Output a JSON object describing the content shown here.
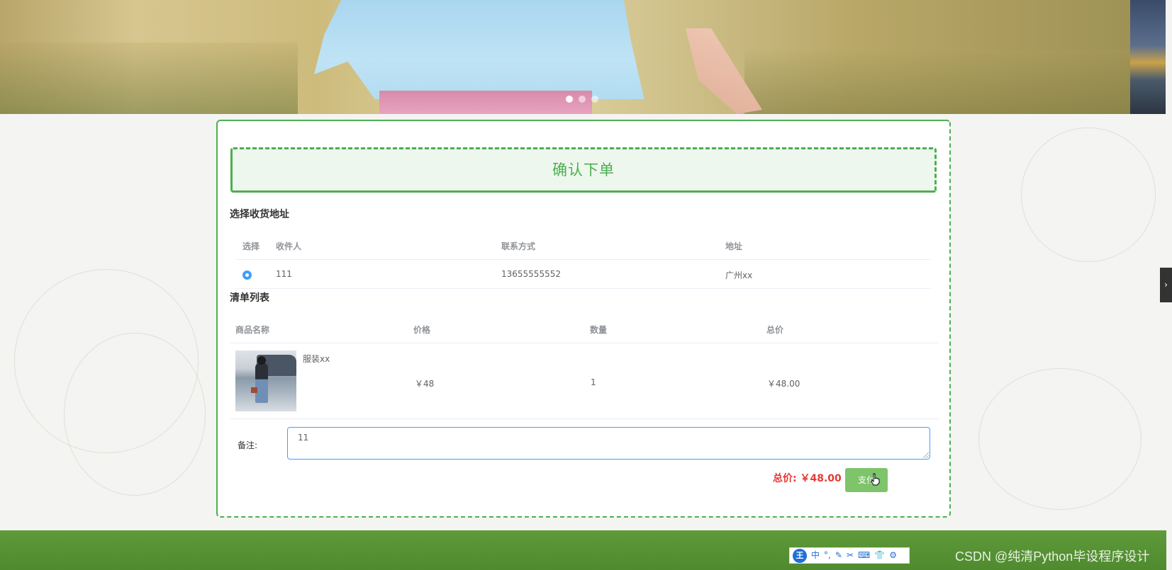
{
  "banner": {
    "dots": [
      true,
      false,
      false
    ]
  },
  "order": {
    "title": "确认下单",
    "address_section": {
      "heading": "选择收货地址",
      "columns": [
        "选择",
        "收件人",
        "联系方式",
        "地址"
      ],
      "rows": [
        {
          "selected": true,
          "recipient": "111",
          "phone": "13655555552",
          "address": "广州xx"
        }
      ]
    },
    "cart_section": {
      "heading": "清单列表",
      "columns": [
        "商品名称",
        "价格",
        "数量",
        "总价"
      ],
      "rows": [
        {
          "name": "服装xx",
          "price": "￥48",
          "quantity": "1",
          "subtotal": "￥48.00"
        }
      ]
    },
    "remark": {
      "label": "备注:",
      "value": "11"
    },
    "total_label": "总价: ￥48.00",
    "pay_label": "支付"
  },
  "taskbar": {
    "ime_logo": "王",
    "ime_mode": "中",
    "ime_icons": [
      "°,",
      "✎",
      "✂",
      "⌨",
      "👕",
      "⚙"
    ]
  },
  "watermark": "CSDN @纯清Python毕设程序设计",
  "colors": {
    "accent_green": "#4caf50",
    "pay_button": "#7dc46b",
    "total_red": "#e53935",
    "footer_green": "#5e9a3a",
    "radio_blue": "#409eff"
  }
}
